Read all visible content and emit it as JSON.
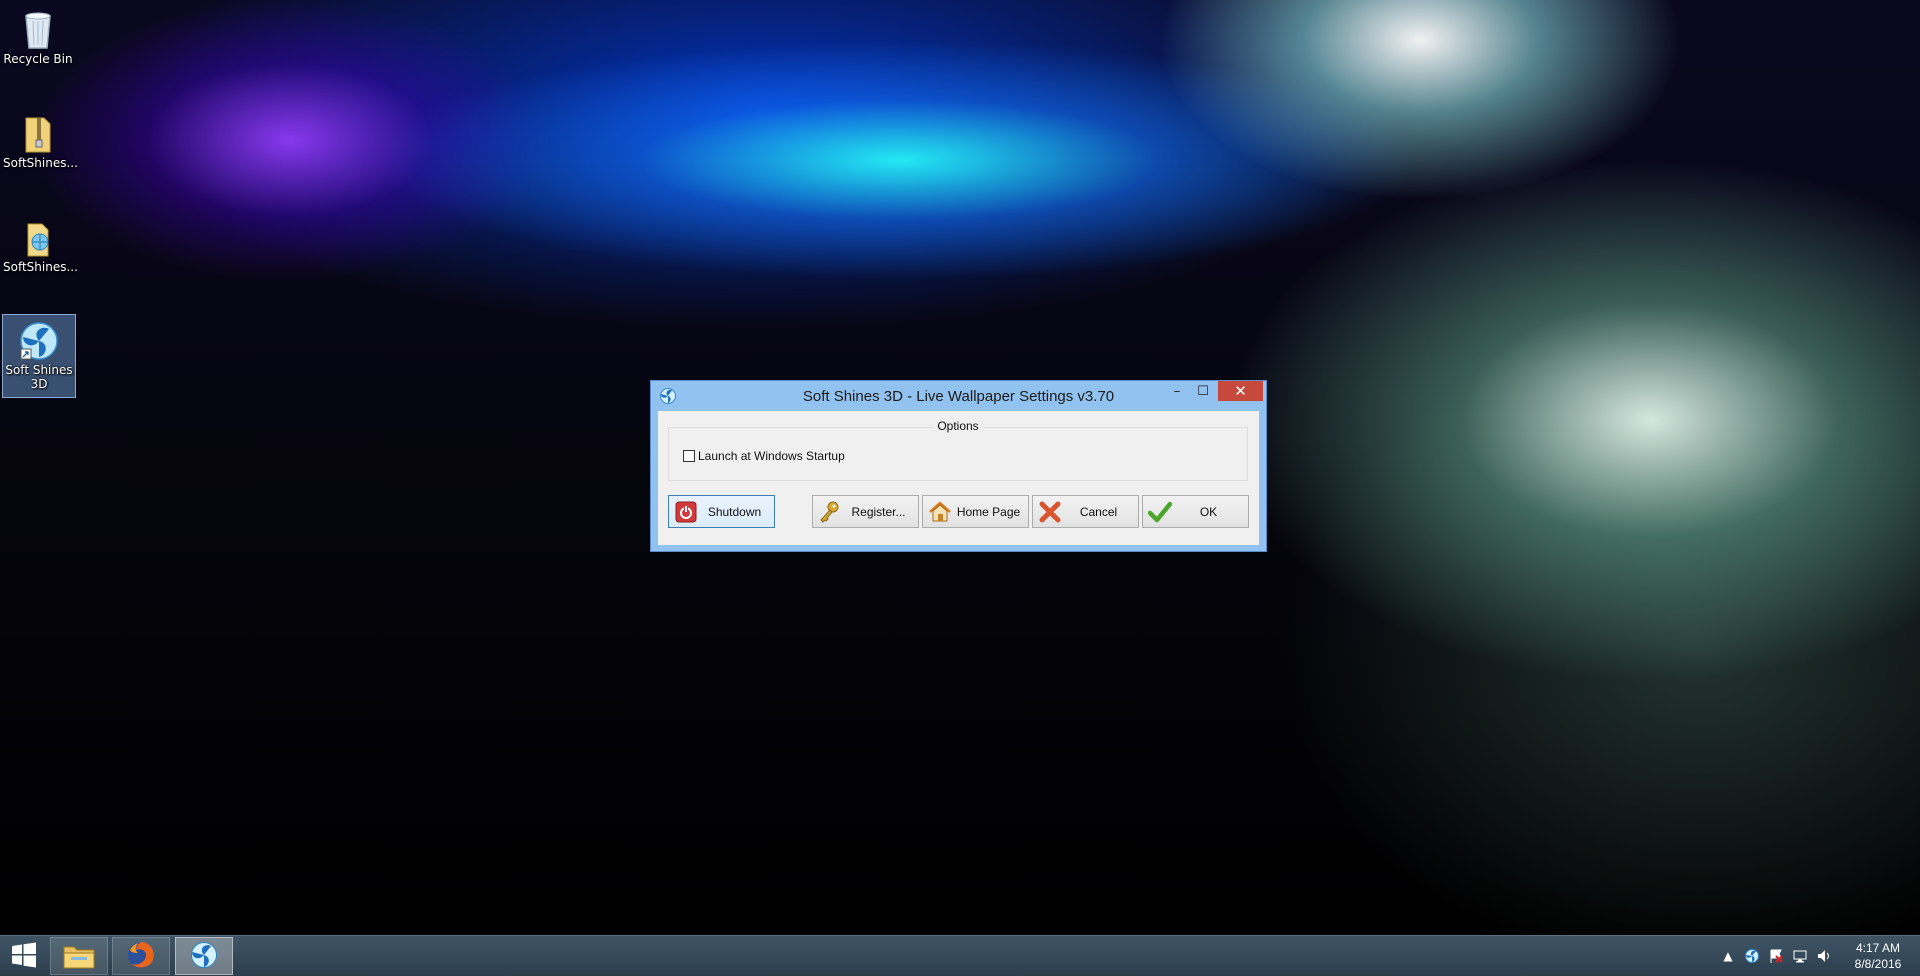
{
  "desktop": {
    "icons": [
      {
        "label": "Recycle Bin",
        "icon": "recycle-bin-icon"
      },
      {
        "label": "SoftShines...",
        "icon": "zip-folder-icon"
      },
      {
        "label": "SoftShines...",
        "icon": "folder-icon"
      },
      {
        "label": "Soft Shines 3D",
        "icon": "soft-shines-shortcut-icon",
        "selected": true
      }
    ]
  },
  "dialog": {
    "title": "Soft Shines 3D - Live Wallpaper Settings  v3.70",
    "titlebar_buttons": {
      "minimize": "–",
      "maximize": "☐",
      "close": "✕"
    },
    "options_group": {
      "legend": "Options"
    },
    "startup_checkbox": {
      "label": "Launch at Windows Startup",
      "checked": false
    },
    "buttons": {
      "shutdown": "Shutdown",
      "register": "Register...",
      "homepage": "Home Page",
      "cancel": "Cancel",
      "ok": "OK"
    }
  },
  "taskbar": {
    "apps": [
      {
        "name": "File Explorer",
        "icon": "file-explorer-icon"
      },
      {
        "name": "Firefox",
        "icon": "firefox-icon"
      },
      {
        "name": "Soft Shines 3D",
        "icon": "soft-shines-icon",
        "active": true
      }
    ],
    "tray": [
      "show-hidden-icons",
      "soft-shines-tray-icon",
      "action-center-flag-icon",
      "network-icon",
      "volume-icon"
    ],
    "clock": {
      "time": "4:17 AM",
      "date": "8/8/2016"
    }
  },
  "colors": {
    "titlebar": "#92c2ef",
    "close_button": "#c7493b",
    "taskbar": "#34495a",
    "shutdown_icon": "#d03a3a",
    "cancel_icon": "#d9552e",
    "ok_icon": "#4ea52c"
  }
}
